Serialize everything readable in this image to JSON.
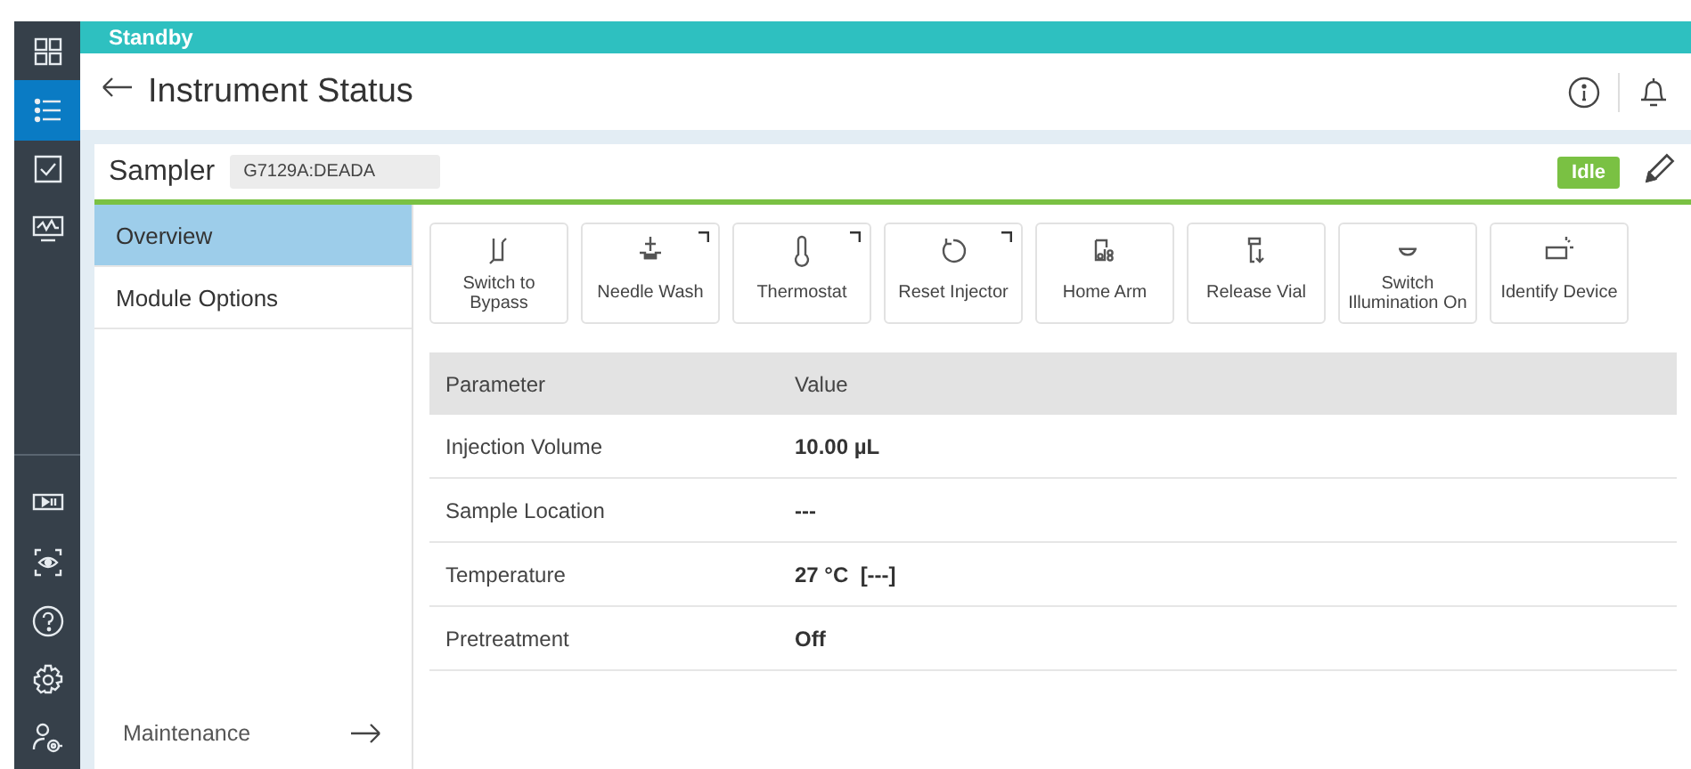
{
  "status_bar": {
    "text": "Standby"
  },
  "header": {
    "title": "Instrument Status"
  },
  "sidebar": {
    "items": [
      {
        "kind": "grid",
        "selected": false
      },
      {
        "kind": "list",
        "selected": true
      },
      {
        "kind": "check",
        "selected": false
      },
      {
        "kind": "monitor",
        "selected": false
      },
      {
        "kind": "divider"
      },
      {
        "kind": "playpause",
        "selected": false
      },
      {
        "kind": "eye",
        "selected": false
      },
      {
        "kind": "help",
        "selected": false
      },
      {
        "kind": "gear",
        "selected": false
      },
      {
        "kind": "usergear",
        "selected": false
      }
    ]
  },
  "module": {
    "name": "Sampler",
    "id": "G7129A:DEADA",
    "status": "Idle"
  },
  "nav": {
    "items": [
      {
        "label": "Overview",
        "selected": true
      },
      {
        "label": "Module Options",
        "selected": false
      }
    ],
    "footer": "Maintenance"
  },
  "actions": [
    {
      "kind": "bypass",
      "label": "Switch to Bypass",
      "has_menu": false
    },
    {
      "kind": "wash",
      "label": "Needle Wash",
      "has_menu": true
    },
    {
      "kind": "thermo",
      "label": "Thermostat",
      "has_menu": true
    },
    {
      "kind": "reset",
      "label": "Reset Injector",
      "has_menu": true
    },
    {
      "kind": "arm",
      "label": "Home Arm",
      "has_menu": false
    },
    {
      "kind": "vial",
      "label": "Release Vial",
      "has_menu": false
    },
    {
      "kind": "light",
      "label": "Switch Illumination On",
      "has_menu": false
    },
    {
      "kind": "identify",
      "label": "Identify Device",
      "has_menu": false
    }
  ],
  "table": {
    "columns": [
      "Parameter",
      "Value"
    ],
    "rows": [
      [
        "Injection Volume",
        "10.00 µL"
      ],
      [
        "Sample Location",
        "---"
      ],
      [
        "Temperature",
        "27 °C  [---]"
      ],
      [
        "Pretreatment",
        "Off"
      ]
    ]
  }
}
